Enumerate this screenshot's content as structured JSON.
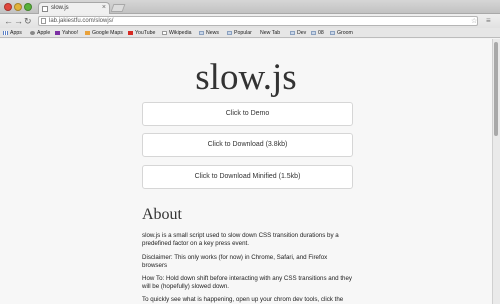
{
  "browser": {
    "tab_title": "slow.js",
    "tab_close": "×",
    "url": "lab.jakiestfu.com/slowjs/",
    "nav": {
      "back": "←",
      "forward": "→",
      "reload": "↻"
    },
    "star": "☆",
    "menu": "≡"
  },
  "bookmarks": [
    {
      "label": "Apps",
      "icon": "grid"
    },
    {
      "label": "Apple",
      "icon": "apple"
    },
    {
      "label": "Yahoo!",
      "icon": "yahoo"
    },
    {
      "label": "Google Maps",
      "icon": "maps"
    },
    {
      "label": "YouTube",
      "icon": "yt"
    },
    {
      "label": "Wikipedia",
      "icon": "wiki"
    },
    {
      "label": "News",
      "icon": "folder"
    },
    {
      "label": "Popular",
      "icon": "folder"
    },
    {
      "label": "New Tab",
      "icon": "page"
    },
    {
      "label": "Dev",
      "icon": "folder"
    },
    {
      "label": "08",
      "icon": "folder"
    },
    {
      "label": "Groom",
      "icon": "folder"
    }
  ],
  "page": {
    "title": "slow.js",
    "buttons": {
      "demo": "Click to Demo",
      "download": "Click to Download (3.8kb)",
      "download_min": "Click to Download Minified (1.5kb)"
    },
    "about_heading": "About",
    "paragraphs": [
      "slow.js is a small script used to slow down CSS transition durations by a predefined factor on a key press event.",
      "Disclaimer: This only works (for now) in Chrome, Safari, and Firefox browsers",
      "How To: Hold down shift before interacting with any CSS transitions and they will be (hopefully) slowed down.",
      "To quickly see what is happening, open up your chrom dev tools, click the"
    ]
  }
}
